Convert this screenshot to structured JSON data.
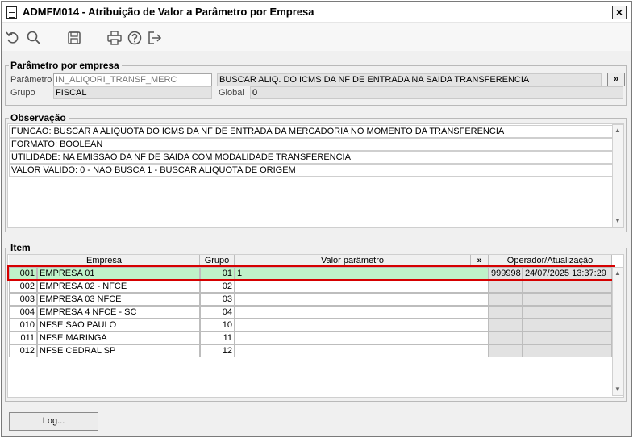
{
  "window": {
    "title": "ADMFM014 - Atribuição de Valor a Parâmetro por Empresa",
    "close": "×"
  },
  "toolbar": [
    "undo-icon",
    "search-icon",
    "save-icon",
    "print-icon",
    "help-icon",
    "exit-icon"
  ],
  "param": {
    "legend": "Parâmetro por empresa",
    "param_label": "Parâmetro",
    "param_value": "IN_ALIQORI_TRANSF_MERC",
    "description": "BUSCAR ALIQ. DO ICMS DA NF DE ENTRADA NA SAIDA TRANSFERENCIA",
    "expand": "»",
    "group_label": "Grupo",
    "group_value": "FISCAL",
    "global_label": "Global",
    "global_value": "0"
  },
  "obs": {
    "legend": "Observação",
    "lines": [
      "FUNCAO: BUSCAR A ALIQUOTA DO ICMS DA NF DE ENTRADA DA MERCADORIA NO MOMENTO DA TRANSFERENCIA",
      "FORMATO: BOOLEAN",
      "UTILIDADE: NA EMISSAO DA NF DE SAIDA COM MODALIDADE TRANSFERENCIA",
      "VALOR VALIDO: 0 - NAO BUSCA 1 - BUSCAR ALIQUOTA DE ORIGEM"
    ]
  },
  "items": {
    "legend": "Item",
    "headers": {
      "empresa": "Empresa",
      "grupo": "Grupo",
      "valor": "Valor parâmetro",
      "expand": "»",
      "operador": "Operador/Atualização"
    },
    "rows": [
      {
        "code": "001",
        "name": "EMPRESA 01",
        "grupo": "01",
        "valor": "1",
        "op": "999998",
        "date": "24/07/2025 13:37:29"
      },
      {
        "code": "002",
        "name": "EMPRESA 02 - NFCE",
        "grupo": "02",
        "valor": "",
        "op": "",
        "date": ""
      },
      {
        "code": "003",
        "name": "EMPRESA 03 NFCE",
        "grupo": "03",
        "valor": "",
        "op": "",
        "date": ""
      },
      {
        "code": "004",
        "name": "EMPRESA 4 NFCE - SC",
        "grupo": "04",
        "valor": "",
        "op": "",
        "date": ""
      },
      {
        "code": "010",
        "name": "NFSE SAO PAULO",
        "grupo": "10",
        "valor": "",
        "op": "",
        "date": ""
      },
      {
        "code": "011",
        "name": "NFSE MARINGA",
        "grupo": "11",
        "valor": "",
        "op": "",
        "date": ""
      },
      {
        "code": "012",
        "name": "NFSE CEDRAL SP",
        "grupo": "12",
        "valor": "",
        "op": "",
        "date": ""
      }
    ]
  },
  "footer": {
    "log": "Log..."
  }
}
